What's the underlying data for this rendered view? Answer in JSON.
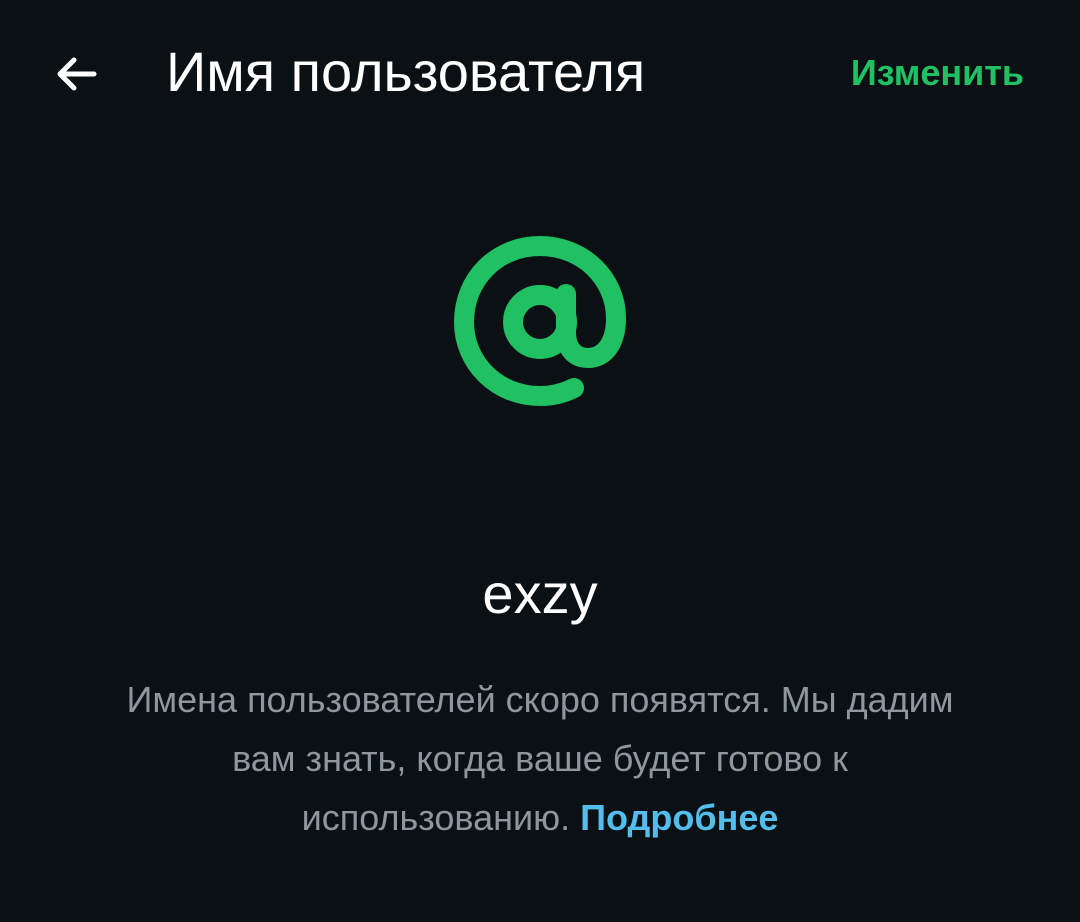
{
  "header": {
    "title": "Имя пользователя",
    "edit_label": "Изменить"
  },
  "icons": {
    "back": "arrow-left-icon",
    "main": "at-sign-icon"
  },
  "profile": {
    "username": "exzy"
  },
  "info": {
    "text": "Имена пользователей скоро появятся. Мы дадим вам знать, когда ваше будет готово к использованию.",
    "link_label": "Подробнее"
  },
  "colors": {
    "background": "#0b1014",
    "accent_green": "#21c063",
    "link_blue": "#53bdeb",
    "secondary_text": "#8d979d",
    "primary_text": "#ffffff"
  }
}
